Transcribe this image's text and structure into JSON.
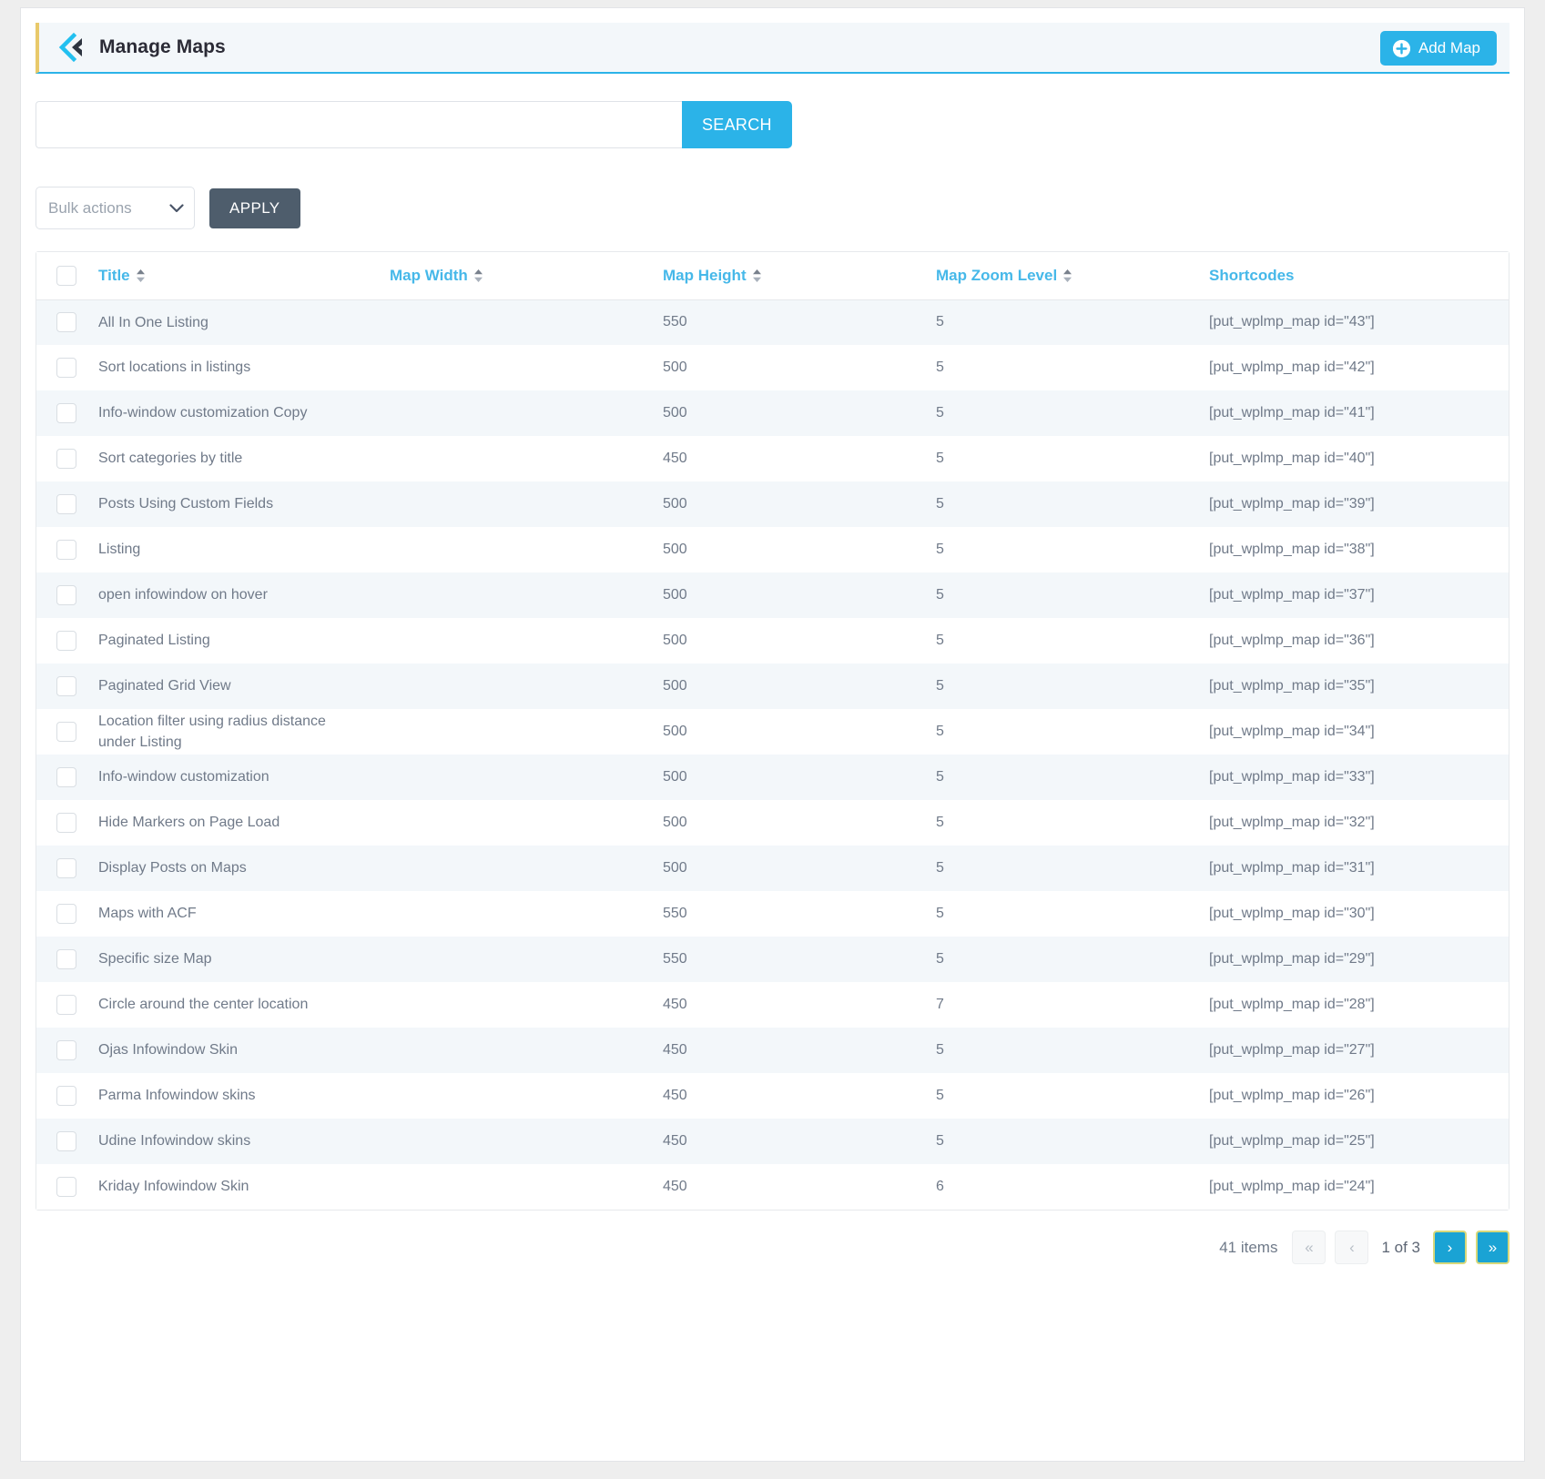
{
  "header": {
    "logo_icon": "double-chevron-left-logo",
    "title": "Manage Maps",
    "add_map_label": "Add Map",
    "add_icon": "plus-circle-icon",
    "accent_color": "#2bb3e8",
    "left_accent_color": "#e8c96a"
  },
  "search": {
    "value": "",
    "placeholder": "",
    "button_label": "SEARCH"
  },
  "bulk": {
    "selected": "Bulk actions",
    "options": [
      "Bulk actions"
    ],
    "apply_label": "APPLY",
    "chevron_icon": "chevron-down-icon"
  },
  "table": {
    "columns": [
      {
        "key": "title",
        "label": "Title",
        "sortable": true
      },
      {
        "key": "width",
        "label": "Map Width",
        "sortable": true
      },
      {
        "key": "height",
        "label": "Map Height",
        "sortable": true
      },
      {
        "key": "zoom",
        "label": "Map Zoom Level",
        "sortable": true
      },
      {
        "key": "short",
        "label": "Shortcodes",
        "sortable": false
      }
    ],
    "rows": [
      {
        "title": "All In One Listing",
        "width": "",
        "height": "550",
        "zoom": "5",
        "short": "[put_wplmp_map id=\"43\"]"
      },
      {
        "title": "Sort locations in listings",
        "width": "",
        "height": "500",
        "zoom": "5",
        "short": "[put_wplmp_map id=\"42\"]"
      },
      {
        "title": "Info-window customization Copy",
        "width": "",
        "height": "500",
        "zoom": "5",
        "short": "[put_wplmp_map id=\"41\"]"
      },
      {
        "title": "Sort categories by title",
        "width": "",
        "height": "450",
        "zoom": "5",
        "short": "[put_wplmp_map id=\"40\"]"
      },
      {
        "title": "Posts Using Custom Fields",
        "width": "",
        "height": "500",
        "zoom": "5",
        "short": "[put_wplmp_map id=\"39\"]"
      },
      {
        "title": "Listing",
        "width": "",
        "height": "500",
        "zoom": "5",
        "short": "[put_wplmp_map id=\"38\"]"
      },
      {
        "title": "open infowindow on hover",
        "width": "",
        "height": "500",
        "zoom": "5",
        "short": "[put_wplmp_map id=\"37\"]"
      },
      {
        "title": "Paginated Listing",
        "width": "",
        "height": "500",
        "zoom": "5",
        "short": "[put_wplmp_map id=\"36\"]"
      },
      {
        "title": "Paginated Grid View",
        "width": "",
        "height": "500",
        "zoom": "5",
        "short": "[put_wplmp_map id=\"35\"]"
      },
      {
        "title": "Location filter using radius distance under Listing",
        "width": "",
        "height": "500",
        "zoom": "5",
        "short": "[put_wplmp_map id=\"34\"]"
      },
      {
        "title": "Info-window customization",
        "width": "",
        "height": "500",
        "zoom": "5",
        "short": "[put_wplmp_map id=\"33\"]"
      },
      {
        "title": "Hide Markers on Page Load",
        "width": "",
        "height": "500",
        "zoom": "5",
        "short": "[put_wplmp_map id=\"32\"]"
      },
      {
        "title": "Display Posts on Maps",
        "width": "",
        "height": "500",
        "zoom": "5",
        "short": "[put_wplmp_map id=\"31\"]"
      },
      {
        "title": "Maps with ACF",
        "width": "",
        "height": "550",
        "zoom": "5",
        "short": "[put_wplmp_map id=\"30\"]"
      },
      {
        "title": "Specific size Map",
        "width": "",
        "height": "550",
        "zoom": "5",
        "short": "[put_wplmp_map id=\"29\"]"
      },
      {
        "title": "Circle around the center location",
        "width": "",
        "height": "450",
        "zoom": "7",
        "short": "[put_wplmp_map id=\"28\"]"
      },
      {
        "title": "Ojas Infowindow Skin",
        "width": "",
        "height": "450",
        "zoom": "5",
        "short": "[put_wplmp_map id=\"27\"]"
      },
      {
        "title": "Parma Infowindow skins",
        "width": "",
        "height": "450",
        "zoom": "5",
        "short": "[put_wplmp_map id=\"26\"]"
      },
      {
        "title": "Udine Infowindow skins",
        "width": "",
        "height": "450",
        "zoom": "5",
        "short": "[put_wplmp_map id=\"25\"]"
      },
      {
        "title": "Kriday Infowindow Skin",
        "width": "",
        "height": "450",
        "zoom": "6",
        "short": "[put_wplmp_map id=\"24\"]"
      }
    ]
  },
  "pagination": {
    "items_label": "41 items",
    "first_label": "«",
    "prev_label": "‹",
    "page_label": "1 of 3",
    "next_label": "›",
    "last_label": "»",
    "current_page": 1,
    "total_pages": 3,
    "active_color": "#1aa3d4",
    "active_border_color": "#d8d87a"
  }
}
